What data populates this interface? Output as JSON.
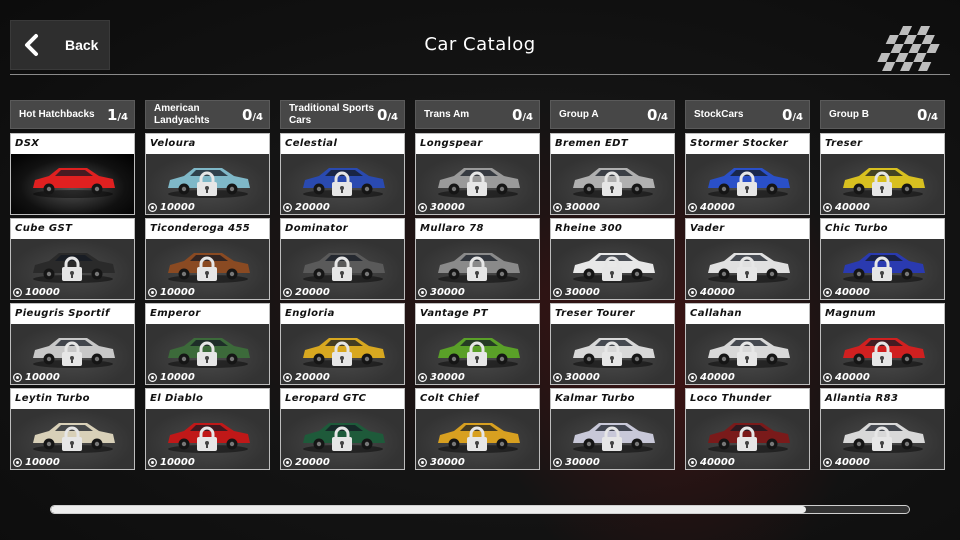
{
  "header": {
    "back_label": "Back",
    "title": "Car Catalog"
  },
  "icons": {
    "back": "chevron-left-icon",
    "flag": "checkered-flag-icon",
    "lock": "lock-icon",
    "coin": "coin-icon"
  },
  "colors": {
    "accent": "#ffffff",
    "header_bg": "#474747",
    "card_bg": "#3b3b3b"
  },
  "scrollbar": {
    "progress": 0.88
  },
  "categories": [
    {
      "name": "Hot Hatchbacks",
      "owned": "1",
      "total": "/4",
      "cars": [
        {
          "name": "DSX",
          "price": "",
          "locked": false,
          "color": "#e02020"
        },
        {
          "name": "Cube GST",
          "price": "10000",
          "locked": true,
          "color": "#2a2a2a"
        },
        {
          "name": "Pieugris Sportif",
          "price": "10000",
          "locked": true,
          "color": "#c8c8c8"
        },
        {
          "name": "Leytin Turbo",
          "price": "10000",
          "locked": true,
          "color": "#d8d0b8"
        }
      ]
    },
    {
      "name": "American Landyachts",
      "owned": "0",
      "total": "/4",
      "cars": [
        {
          "name": "Veloura",
          "price": "10000",
          "locked": true,
          "color": "#7fb8c8"
        },
        {
          "name": "Ticonderoga 455",
          "price": "10000",
          "locked": true,
          "color": "#8a4a22"
        },
        {
          "name": "Emperor",
          "price": "10000",
          "locked": true,
          "color": "#3c6a3a"
        },
        {
          "name": "El Diablo",
          "price": "10000",
          "locked": true,
          "color": "#c01818"
        }
      ]
    },
    {
      "name": "Traditional Sports Cars",
      "owned": "0",
      "total": "/4",
      "cars": [
        {
          "name": "Celestial",
          "price": "20000",
          "locked": true,
          "color": "#2a4ab0"
        },
        {
          "name": "Dominator",
          "price": "20000",
          "locked": true,
          "color": "#5a5a5a"
        },
        {
          "name": "Engloria",
          "price": "20000",
          "locked": true,
          "color": "#d8a820"
        },
        {
          "name": "Leropard GTC",
          "price": "20000",
          "locked": true,
          "color": "#1e5a3a"
        }
      ]
    },
    {
      "name": "Trans Am",
      "owned": "0",
      "total": "/4",
      "cars": [
        {
          "name": "Longspear",
          "price": "30000",
          "locked": true,
          "color": "#9a9a9a"
        },
        {
          "name": "Mullaro 78",
          "price": "30000",
          "locked": true,
          "color": "#8a8a8a"
        },
        {
          "name": "Vantage PT",
          "price": "30000",
          "locked": true,
          "color": "#5aa028"
        },
        {
          "name": "Colt Chief",
          "price": "30000",
          "locked": true,
          "color": "#d8a020"
        }
      ]
    },
    {
      "name": "Group A",
      "owned": "0",
      "total": "/4",
      "cars": [
        {
          "name": "Bremen EDT",
          "price": "30000",
          "locked": true,
          "color": "#b0b0b0"
        },
        {
          "name": "Rheine 300",
          "price": "30000",
          "locked": true,
          "color": "#e8e8e8"
        },
        {
          "name": "Treser Tourer",
          "price": "30000",
          "locked": true,
          "color": "#d8d8d8"
        },
        {
          "name": "Kalmar Turbo",
          "price": "30000",
          "locked": true,
          "color": "#c8c8d8"
        }
      ]
    },
    {
      "name": "StockCars",
      "owned": "0",
      "total": "/4",
      "cars": [
        {
          "name": "Stormer Stocker",
          "price": "40000",
          "locked": true,
          "color": "#2a50c8"
        },
        {
          "name": "Vader",
          "price": "40000",
          "locked": true,
          "color": "#e0e0e0"
        },
        {
          "name": "Callahan",
          "price": "40000",
          "locked": true,
          "color": "#d8d8d8"
        },
        {
          "name": "Loco Thunder",
          "price": "40000",
          "locked": true,
          "color": "#7a1a1a"
        }
      ]
    },
    {
      "name": "Group B",
      "owned": "0",
      "total": "/4",
      "cars": [
        {
          "name": "Treser",
          "price": "40000",
          "locked": true,
          "color": "#d8c020"
        },
        {
          "name": "Chic Turbo",
          "price": "40000",
          "locked": true,
          "color": "#2a3ab0"
        },
        {
          "name": "Magnum",
          "price": "40000",
          "locked": true,
          "color": "#d02020"
        },
        {
          "name": "Allantia R83",
          "price": "40000",
          "locked": true,
          "color": "#d8d8d8"
        }
      ]
    }
  ]
}
